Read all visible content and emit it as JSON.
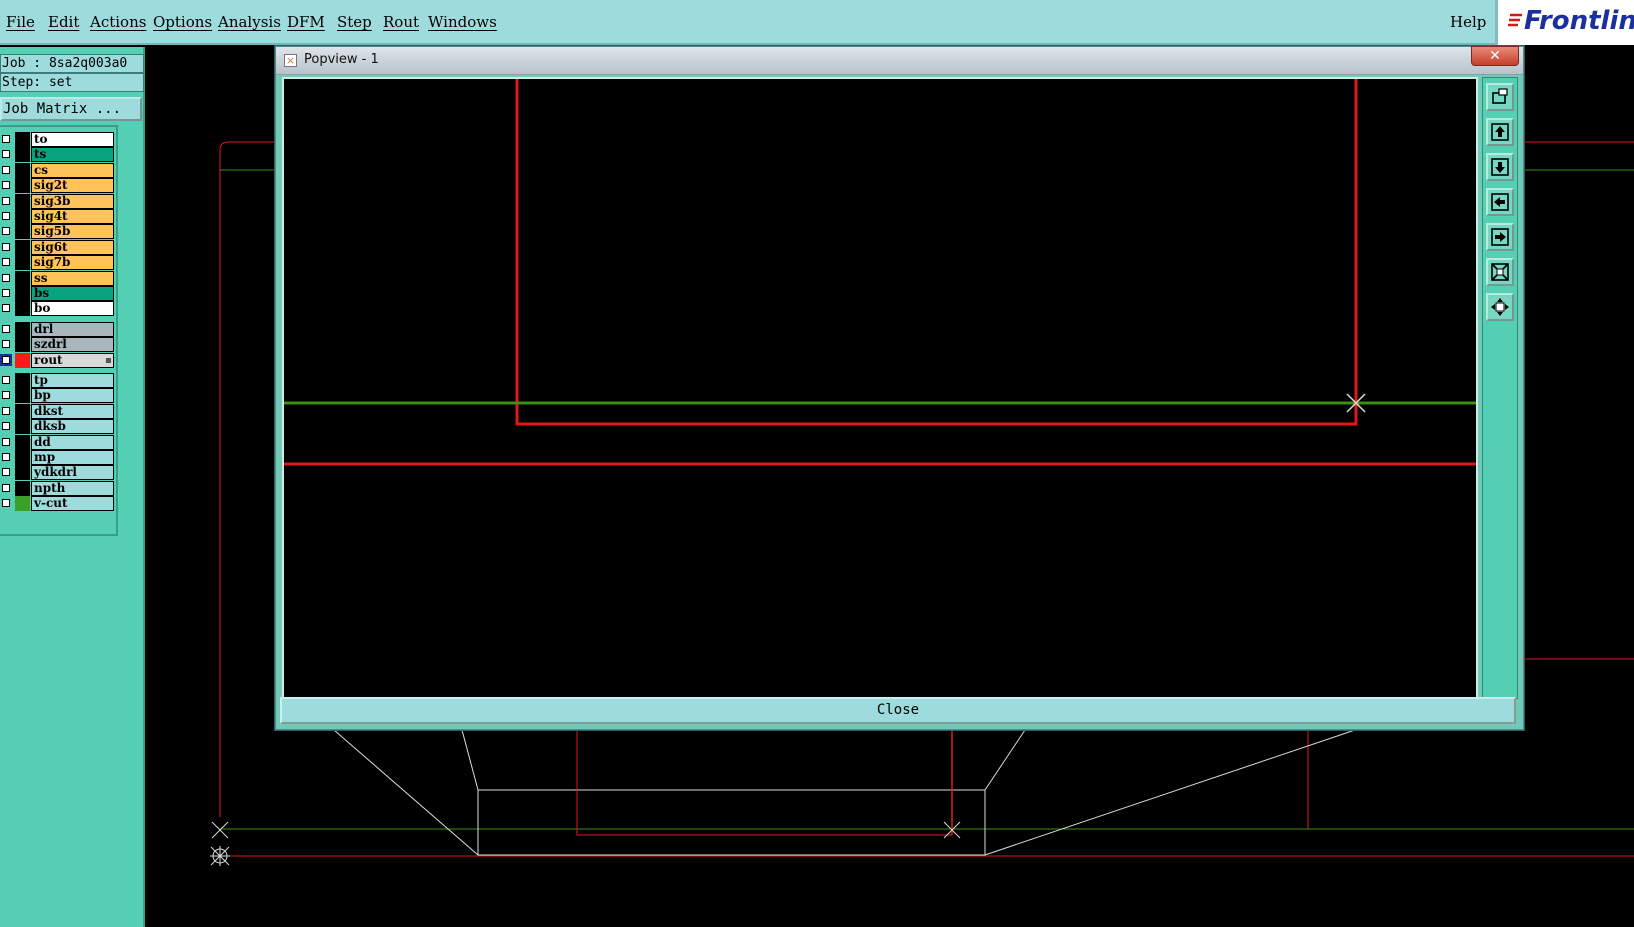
{
  "menubar": {
    "items": [
      "File",
      "Edit",
      "Actions",
      "Options",
      "Analysis",
      "DFM",
      "Step",
      "Rout",
      "Windows"
    ],
    "help": "Help",
    "brand": "Frontline"
  },
  "job_info": {
    "job": "Job : 8sa2q003a0",
    "step": "Step: set",
    "job_matrix_label": "Job Matrix ..."
  },
  "layers": [
    {
      "name": "to",
      "color": "#ffffff"
    },
    {
      "name": "ts",
      "color": "#0aa37f"
    },
    {
      "name": "cs",
      "color": "#ffc35a"
    },
    {
      "name": "sig2t",
      "color": "#ffc35a"
    },
    {
      "name": "sig3b",
      "color": "#ffc35a"
    },
    {
      "name": "sig4t",
      "color": "#ffc35a"
    },
    {
      "name": "sig5b",
      "color": "#ffc35a"
    },
    {
      "name": "sig6t",
      "color": "#ffc35a"
    },
    {
      "name": "sig7b",
      "color": "#ffc35a"
    },
    {
      "name": "ss",
      "color": "#ffc35a"
    },
    {
      "name": "bs",
      "color": "#0aa37f"
    },
    {
      "name": "bo",
      "color": "#ffffff"
    },
    {
      "name": "drl",
      "color": "#a9b7bd"
    },
    {
      "name": "szdrl",
      "color": "#a9b7bd"
    },
    {
      "name": "rout",
      "color": "#d9d9d9",
      "active": true,
      "swatch": "#ff1a1a"
    },
    {
      "name": "tp",
      "color": "#9ddbdc"
    },
    {
      "name": "bp",
      "color": "#9ddbdc"
    },
    {
      "name": "dkst",
      "color": "#9ddbdc"
    },
    {
      "name": "dksb",
      "color": "#9ddbdc"
    },
    {
      "name": "dd",
      "color": "#9ddbdc"
    },
    {
      "name": "mp",
      "color": "#9ddbdc"
    },
    {
      "name": "ydkdrl",
      "color": "#9ddbdc"
    },
    {
      "name": "npth",
      "color": "#9ddbdc"
    },
    {
      "name": "v-cut",
      "color": "#9ddbdc",
      "swatch": "#3aa02a"
    }
  ],
  "popview": {
    "title": "Popview - 1",
    "close_label": "Close",
    "close_x": "✕",
    "tools": [
      "zoom-window-icon",
      "pan-up-icon",
      "pan-down-icon",
      "pan-left-icon",
      "pan-right-icon",
      "zoom-out-icon",
      "zoom-in-icon"
    ]
  },
  "colors": {
    "rout": "#e01818",
    "green_line": "#3c8f12",
    "white_line": "#dcdcdc",
    "menu_bg": "#9ddbdc",
    "panel_bg": "#54cfb3"
  }
}
